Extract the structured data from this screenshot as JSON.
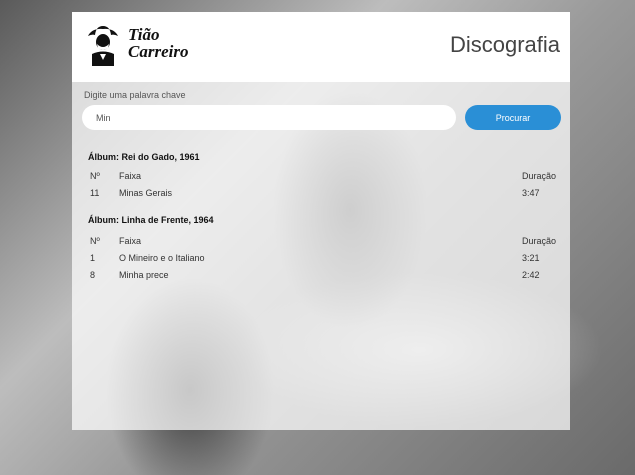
{
  "header": {
    "brand_line1": "Tião",
    "brand_line2": "Carreiro",
    "title": "Discografia"
  },
  "search": {
    "label": "Digite uma palavra chave",
    "value": "Min",
    "button_label": "Procurar"
  },
  "albums": [
    {
      "title": "Álbum: Rei do Gado, 1961",
      "columns": [
        "Nº",
        "Faixa",
        "Duração"
      ],
      "tracks": [
        {
          "num": "11",
          "name": "Minas Gerais",
          "duration": "3:47"
        }
      ]
    },
    {
      "title": "Álbum: Linha de Frente, 1964",
      "columns": [
        "Nº",
        "Faixa",
        "Duração"
      ],
      "tracks": [
        {
          "num": "1",
          "name": "O Mineiro e o Italiano",
          "duration": "3:21"
        },
        {
          "num": "8",
          "name": "Minha prece",
          "duration": "2:42"
        }
      ]
    }
  ],
  "colors": {
    "accent": "#2a8fd6",
    "panel": "#ffffff"
  }
}
